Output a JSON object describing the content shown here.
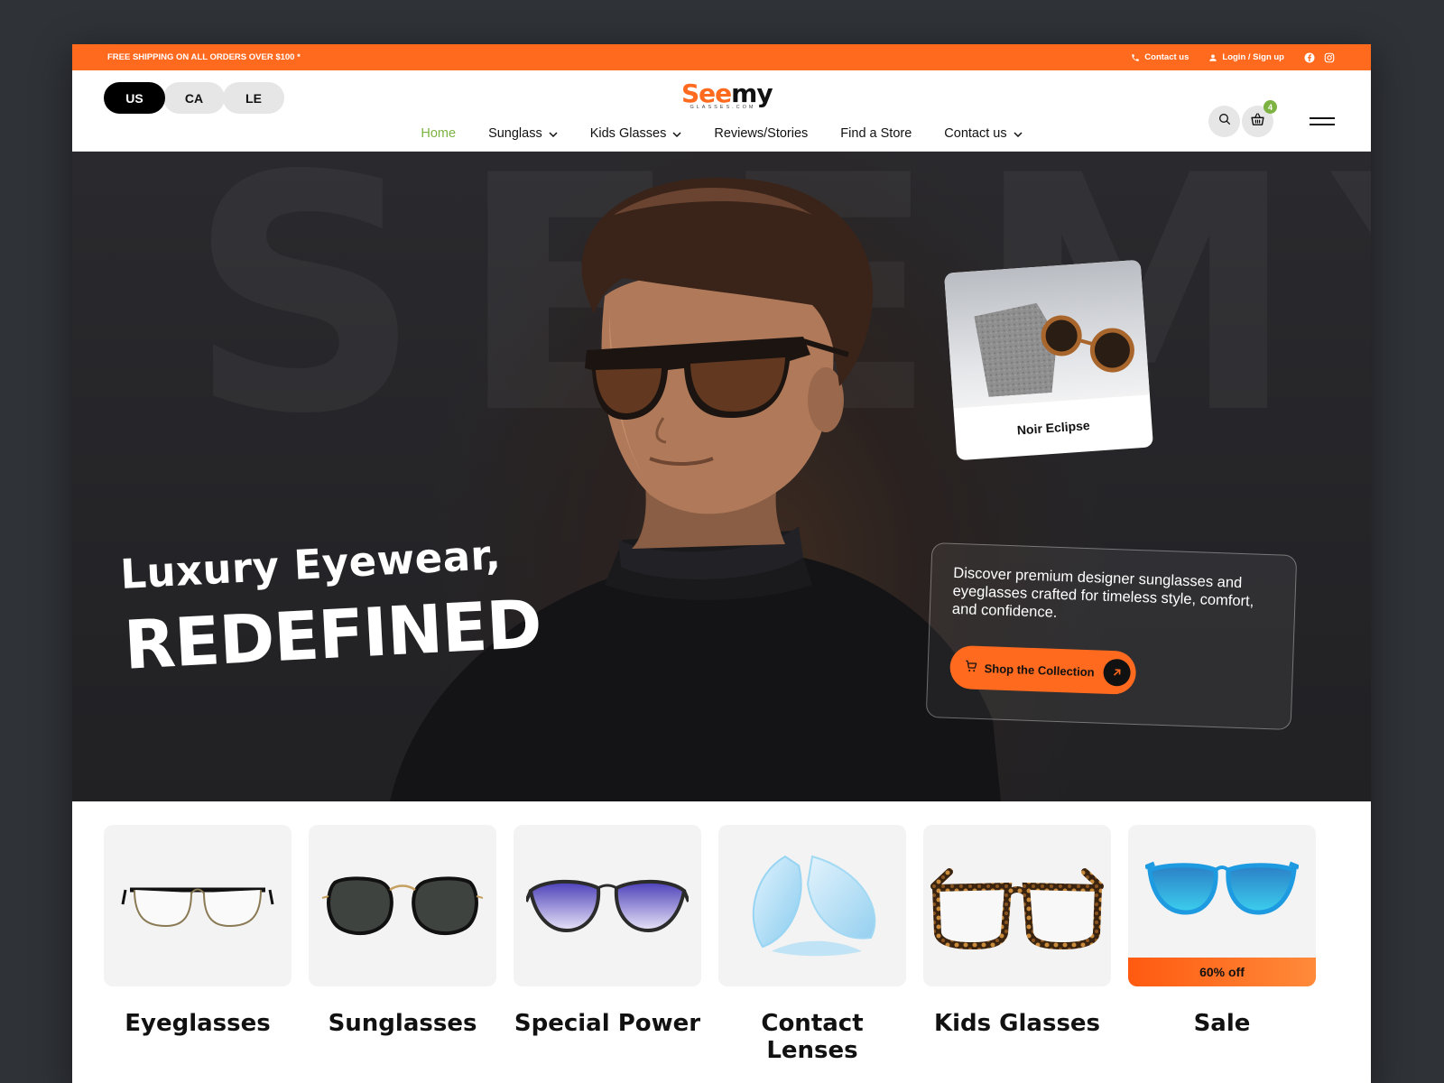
{
  "topbar": {
    "shipping": "FREE SHIPPING ON ALL ORDERS OVER $100 *",
    "contact": "Contact us",
    "login": "Login / Sign up",
    "social_icons": [
      "facebook-icon",
      "instagram-icon"
    ]
  },
  "regions": [
    {
      "label": "US",
      "active": true
    },
    {
      "label": "CA",
      "active": false
    },
    {
      "label": "LE",
      "active": false
    }
  ],
  "logo": {
    "main": "Seemy",
    "sub": "GLASSES.COM"
  },
  "cart": {
    "count": "4"
  },
  "nav": [
    {
      "label": "Home",
      "active": true,
      "dropdown": false
    },
    {
      "label": "Sunglass",
      "active": false,
      "dropdown": true
    },
    {
      "label": "Kids Glasses",
      "active": false,
      "dropdown": true
    },
    {
      "label": "Reviews/Stories",
      "active": false,
      "dropdown": false
    },
    {
      "label": "Find a Store",
      "active": false,
      "dropdown": false
    },
    {
      "label": "Contact us",
      "active": false,
      "dropdown": true
    }
  ],
  "hero": {
    "background_word": "SEEMY",
    "tagline_line1": "Luxury Eyewear,",
    "tagline_line2": "REDEFINED",
    "product_card": {
      "name": "Noir Eclipse"
    },
    "description": "Discover premium designer sunglasses and eyeglasses crafted for timeless style, comfort, and confidence.",
    "cta": "Shop the Collection"
  },
  "categories": [
    {
      "label": "Eyeglasses"
    },
    {
      "label": "Sunglasses"
    },
    {
      "label": "Special Power"
    },
    {
      "label": "Contact Lenses"
    },
    {
      "label": "Kids Glasses"
    },
    {
      "label": "Sale",
      "badge": "60% off"
    }
  ],
  "colors": {
    "accent": "#ff6a1f",
    "active_nav": "#7cb342",
    "dark": "#111111"
  }
}
